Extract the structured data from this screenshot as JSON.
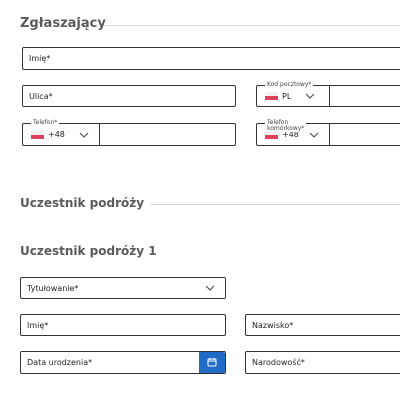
{
  "zglaszajacy": {
    "title": "Zgłaszający",
    "imie_placeholder": "Imię*",
    "ulica_placeholder": "Ulica*",
    "kod_pocztowy": {
      "legend": "Kod pocztowy*",
      "country": "PL"
    },
    "telefon": {
      "legend": "Telefon*",
      "prefix": "+48"
    },
    "telefon_komorkowy": {
      "legend": "Telefon\nkomórkowy*",
      "prefix": "+48"
    }
  },
  "uczestnik": {
    "title": "Uczestnik podróży",
    "subtitle": "Uczestnik podróży 1",
    "tytulowanie_placeholder": "Tytułowanie*",
    "imie_placeholder": "Imię*",
    "nazwisko_placeholder": "Nazwisko*",
    "data_urodzenia_placeholder": "Data urodzenia*",
    "narodowosc_placeholder": "Narodowość*"
  },
  "colors": {
    "accent": "#1f6bc6",
    "flag_red": "#e0405b",
    "heading": "#5a5a5a"
  },
  "icons": {
    "flag": "poland-flag-icon",
    "dropdown": "chevron-down-icon",
    "calendar": "calendar-icon"
  }
}
